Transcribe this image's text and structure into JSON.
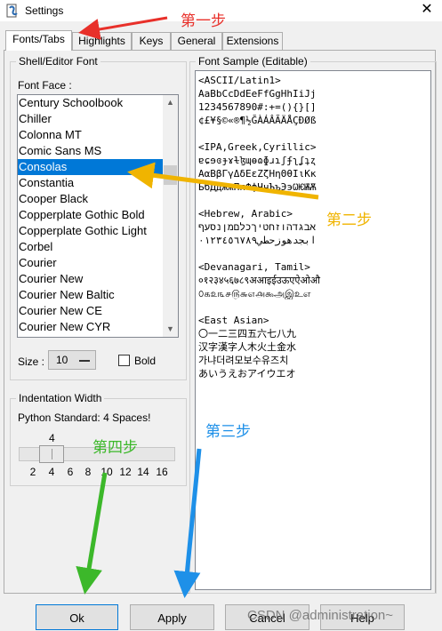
{
  "window": {
    "title": "Settings",
    "close_glyph": "✕"
  },
  "tabs": [
    {
      "label": "Fonts/Tabs",
      "active": true
    },
    {
      "label": "Highlights",
      "active": false
    },
    {
      "label": "Keys",
      "active": false
    },
    {
      "label": "General",
      "active": false
    },
    {
      "label": "Extensions",
      "active": false
    }
  ],
  "font_group": {
    "legend": "Shell/Editor Font",
    "face_label": "Font Face :",
    "fonts": [
      "Century Schoolbook",
      "Chiller",
      "Colonna MT",
      "Comic Sans MS",
      "Consolas",
      "Constantia",
      "Cooper Black",
      "Copperplate Gothic Bold",
      "Copperplate Gothic Light",
      "Corbel",
      "Courier",
      "Courier New",
      "Courier New Baltic",
      "Courier New CE",
      "Courier New CYR"
    ],
    "selected_font": "Consolas",
    "size_label": "Size :",
    "size_value": "10",
    "bold_label": "Bold",
    "bold_checked": false
  },
  "indent_group": {
    "legend": "Indentation Width",
    "description": "Python Standard: 4 Spaces!",
    "value": "4",
    "ticks": [
      "2",
      "4",
      "6",
      "8",
      "10",
      "12",
      "14",
      "16"
    ]
  },
  "sample": {
    "legend": "Font Sample (Editable)",
    "lines": [
      "<ASCII/Latin1>",
      "AaBbCcDdEeFfGgHhIiJj",
      "1234567890#:+=(){}[]",
      "¢£¥§©«®¶½ĞÀÁÂÃÄÅÇÐØß",
      "",
      "<IPA,Greek,Cyrillic>",
      "ɐɕɘɞɟɤɫɮɰɵɷɸɹɿʃʄʅʆʇʐ",
      "ΑαΒβΓγΔδΕεΖζΗηΘθΙιΚκ",
      "БбДдЖжПпФфЧчЪъЭэѠѤѬѪ",
      "",
      "<Hebrew, Arabic>",
      "אבגדהוזחטיךכלםמןנסעף",
      "ابجدهوزحطي٠١٢٣٤٥٦٧٨٩",
      "",
      "<Devanagari, Tamil>",
      "०१२३४५६७८९अआइईउऊएऐओऔ",
      "௦௧௨௩௪௫௬௭௮௯அஇஉஎ",
      "",
      "<East Asian>",
      "〇一二三四五六七八九",
      "汉字漢字人木火土金水",
      "가냐더려모보수유즈치",
      "あいうえおアイウエオ"
    ]
  },
  "buttons": {
    "ok": "Ok",
    "apply": "Apply",
    "cancel": "Cancel",
    "help": "Help"
  },
  "watermark": "CSDN @administration~",
  "annotations": [
    {
      "text": "第一步",
      "color": "#e8302a"
    },
    {
      "text": "第二步",
      "color": "#f0b400"
    },
    {
      "text": "第三步",
      "color": "#1e90e8"
    },
    {
      "text": "第四步",
      "color": "#3cb82a"
    }
  ]
}
